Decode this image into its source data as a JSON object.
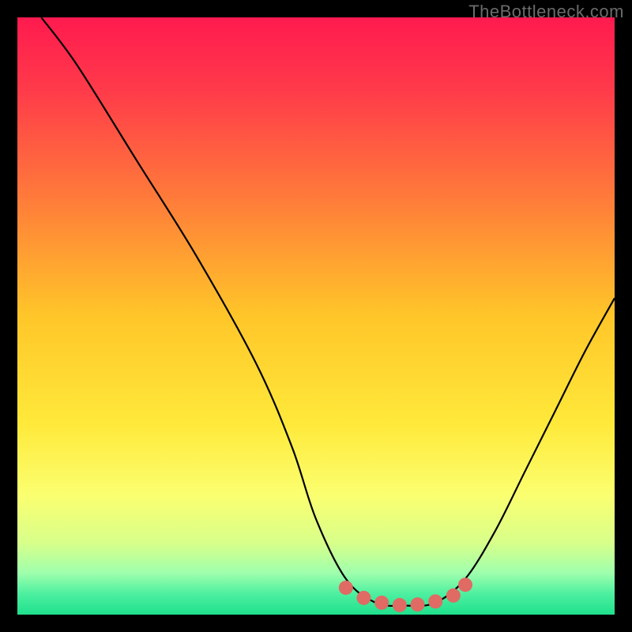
{
  "watermark": "TheBottleneck.com",
  "chart_data": {
    "type": "line",
    "title": "",
    "xlabel": "",
    "ylabel": "",
    "xlim": [
      0,
      100
    ],
    "ylim": [
      0,
      100
    ],
    "series": [
      {
        "name": "bottleneck-curve",
        "x": [
          4,
          10,
          20,
          30,
          40,
          46,
          50,
          55,
          60,
          65,
          70,
          75,
          80,
          85,
          90,
          95,
          100
        ],
        "y": [
          100,
          92,
          76,
          60,
          42,
          28,
          16,
          6,
          2,
          1.5,
          2,
          6,
          14,
          24,
          34,
          44,
          53
        ]
      }
    ],
    "marker_segment": {
      "name": "optimal-range",
      "x": [
        55,
        58,
        61,
        64,
        67,
        70,
        73,
        75
      ],
      "y": [
        4.5,
        2.8,
        2.0,
        1.6,
        1.7,
        2.2,
        3.2,
        5.0
      ],
      "color": "#e06a64",
      "radius_px": 9
    },
    "gradient_stops": [
      {
        "offset": 0.0,
        "color": "#ff1a4f"
      },
      {
        "offset": 0.12,
        "color": "#ff3a4a"
      },
      {
        "offset": 0.3,
        "color": "#ff7a3a"
      },
      {
        "offset": 0.5,
        "color": "#ffc629"
      },
      {
        "offset": 0.68,
        "color": "#ffe93a"
      },
      {
        "offset": 0.8,
        "color": "#fbff70"
      },
      {
        "offset": 0.88,
        "color": "#d8ff8a"
      },
      {
        "offset": 0.93,
        "color": "#9fffad"
      },
      {
        "offset": 0.965,
        "color": "#4df0a0"
      },
      {
        "offset": 1.0,
        "color": "#1fe08c"
      }
    ]
  }
}
